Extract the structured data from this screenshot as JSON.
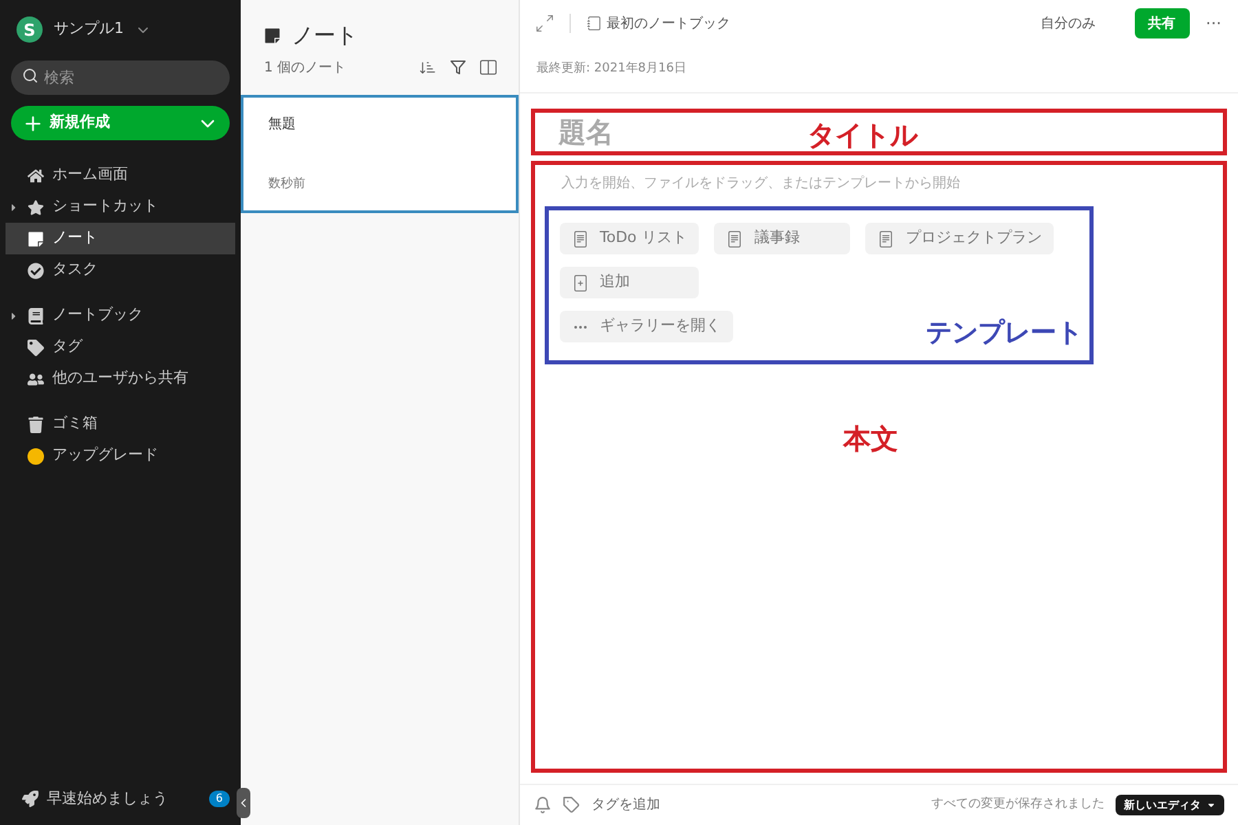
{
  "account": {
    "name": "サンプル1",
    "initial": "S"
  },
  "search": {
    "placeholder": "検索"
  },
  "new_button": {
    "label": "新規作成"
  },
  "sidebar": {
    "sections": [
      [
        {
          "kind": "home",
          "label": "ホーム画面",
          "expandable": false,
          "selected": false
        },
        {
          "kind": "star",
          "label": "ショートカット",
          "expandable": true,
          "selected": false
        },
        {
          "kind": "note",
          "label": "ノート",
          "expandable": false,
          "selected": true
        },
        {
          "kind": "task",
          "label": "タスク",
          "expandable": false,
          "selected": false
        }
      ],
      [
        {
          "kind": "notebook",
          "label": "ノートブック",
          "expandable": true,
          "selected": false
        },
        {
          "kind": "tag",
          "label": "タグ",
          "expandable": false,
          "selected": false
        },
        {
          "kind": "shared",
          "label": "他のユーザから共有",
          "expandable": false,
          "selected": false
        }
      ],
      [
        {
          "kind": "trash",
          "label": "ゴミ箱",
          "expandable": false,
          "selected": false
        },
        {
          "kind": "upgrade",
          "label": "アップグレード",
          "expandable": false,
          "selected": false
        }
      ]
    ],
    "footer": {
      "label": "早速始めましょう",
      "badge": "6"
    }
  },
  "note_list": {
    "title": "ノート",
    "count": "1 個のノート",
    "notes": [
      {
        "title": "無題",
        "time": "数秒前",
        "selected": true
      }
    ]
  },
  "editor": {
    "notebook": "最初のノートブック",
    "visibility": "自分のみ",
    "share_button": "共有",
    "more": "···",
    "last_updated": "最終更新: 2021年8月16日",
    "title_placeholder": "題名",
    "body_placeholder": "入力を開始、ファイルをドラッグ、またはテンプレートから開始",
    "templates": [
      {
        "kind": "template",
        "label": "ToDo リスト"
      },
      {
        "kind": "template",
        "label": "議事録"
      },
      {
        "kind": "template",
        "label": "プロジェクトプラン"
      },
      {
        "kind": "add",
        "label": "追加"
      },
      {
        "kind": "gallery",
        "label": "ギャラリーを開く"
      }
    ],
    "add_tag": "タグを追加",
    "save_status": "すべての変更が保存されました",
    "editor_badge": "新しいエディタ"
  },
  "annotations": {
    "title": "タイトル",
    "templates": "テンプレート",
    "body": "本文"
  }
}
